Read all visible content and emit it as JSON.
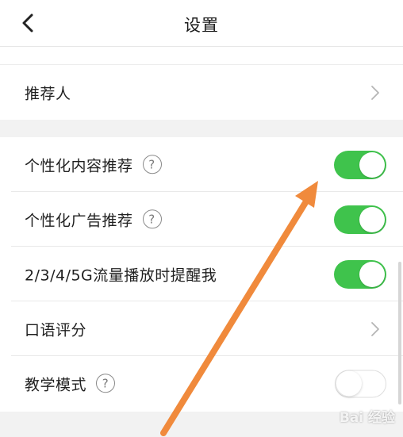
{
  "header": {
    "title": "设置"
  },
  "rows": [
    {
      "label": "推荐人"
    },
    {
      "label": "个性化内容推荐",
      "help": "?"
    },
    {
      "label": "个性化广告推荐",
      "help": "?"
    },
    {
      "label": "2/3/4/5G流量播放时提醒我"
    },
    {
      "label": "口语评分"
    },
    {
      "label": "教学模式",
      "help": "?"
    }
  ],
  "toggles": {
    "personalized_content": "on",
    "personalized_ads": "on",
    "mobile_data_reminder": "on",
    "teaching_mode": "off"
  },
  "colors": {
    "toggle_on": "#3fc34c",
    "annotation_arrow": "#f08a3c"
  },
  "watermark": {
    "text": "Bai 经验"
  }
}
